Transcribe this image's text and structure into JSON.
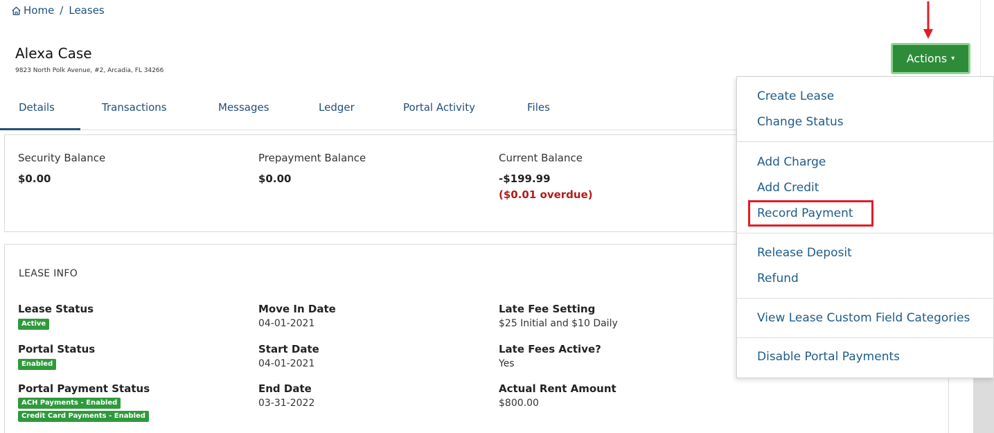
{
  "breadcrumb": {
    "home": "Home",
    "separator": "/",
    "current": "Leases"
  },
  "tenant": {
    "name": "Alexa Case",
    "address": "9823 North Polk Avenue, #2, Arcadia, FL 34266"
  },
  "actions": {
    "label": "Actions",
    "caret": "▾",
    "color": "#2e8b3a"
  },
  "tabs": [
    {
      "label": "Details",
      "active": true
    },
    {
      "label": "Transactions"
    },
    {
      "label": "Messages"
    },
    {
      "label": "Ledger"
    },
    {
      "label": "Portal Activity"
    },
    {
      "label": "Files"
    }
  ],
  "balances": {
    "security": {
      "label": "Security Balance",
      "value": "$0.00"
    },
    "prepayment": {
      "label": "Prepayment Balance",
      "value": "$0.00"
    },
    "current": {
      "label": "Current Balance",
      "value": "-$199.99",
      "overdue": "($0.01 overdue)"
    }
  },
  "lease_info": {
    "title": "LEASE INFO",
    "lease_status": {
      "label": "Lease Status",
      "badge": "Active"
    },
    "portal_status": {
      "label": "Portal Status",
      "badge": "Enabled"
    },
    "portal_payment_status": {
      "label": "Portal Payment Status",
      "badges": [
        "ACH Payments - Enabled",
        "Credit Card Payments - Enabled"
      ]
    },
    "move_in_date": {
      "label": "Move In Date",
      "value": "04-01-2021"
    },
    "start_date": {
      "label": "Start Date",
      "value": "04-01-2021"
    },
    "end_date": {
      "label": "End Date",
      "value": "03-31-2022"
    },
    "late_fee_setting": {
      "label": "Late Fee Setting",
      "value": "$25 Initial and $10 Daily"
    },
    "late_fees_active": {
      "label": "Late Fees Active?",
      "value": "Yes"
    },
    "actual_rent_amount": {
      "label": "Actual Rent Amount",
      "value": "$800.00"
    }
  },
  "menu": {
    "items": [
      "Create Lease",
      "Change Status",
      "Add Charge",
      "Add Credit",
      "Record Payment",
      "Release Deposit",
      "Refund",
      "View Lease Custom Field Categories",
      "Disable Portal Payments"
    ],
    "highlighted": "Record Payment",
    "highlight_color": "#e31b23"
  }
}
